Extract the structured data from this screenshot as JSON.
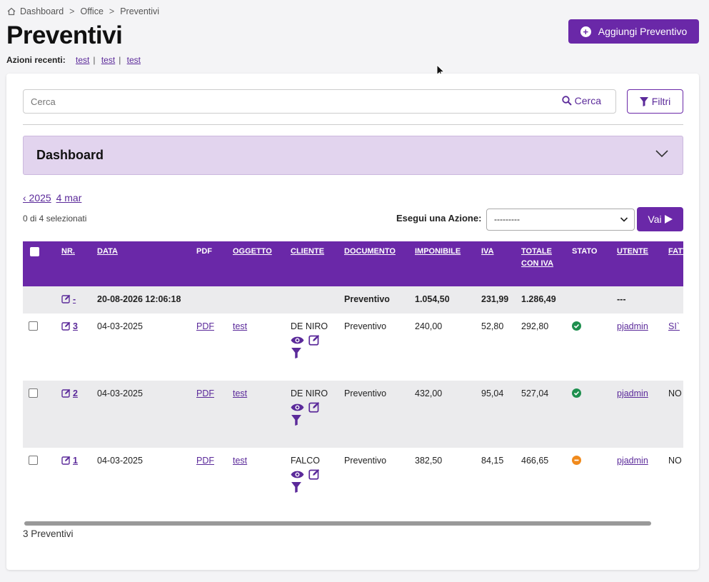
{
  "breadcrumb": [
    "Dashboard",
    "Office",
    "Preventivi"
  ],
  "page_title": "Preventivi",
  "recent": {
    "label": "Azioni recenti",
    "items": [
      "test",
      "test",
      "test"
    ]
  },
  "add_button": "Aggiungi Preventivo",
  "search": {
    "placeholder": "Cerca",
    "button": "Cerca"
  },
  "filters_button": "Filtri",
  "dashboard_panel": "Dashboard",
  "datenav": {
    "year": "‹ 2025",
    "day": "4 mar"
  },
  "selection": "0 di 4 selezionati",
  "action": {
    "label": "Esegui una Azione:",
    "selected": "---------",
    "go": "Vai"
  },
  "columns": [
    "NR.",
    "DATA",
    "PDF",
    "OGGETTO",
    "CLIENTE",
    "DOCUMENTO",
    "IMPONIBILE",
    "IVA",
    "TOTALE CON IVA",
    "STATO",
    "UTENTE",
    "FATT"
  ],
  "summary": {
    "nr": "-",
    "data": "20-08-2026 12:06:18",
    "documento": "Preventivo",
    "imponibile": "1.054,50",
    "iva": "231,99",
    "totale": "1.286,49",
    "utente": "---"
  },
  "rows": [
    {
      "nr": "3",
      "data": "04-03-2025",
      "pdf": "PDF",
      "oggetto": "test",
      "cliente": "DE NIRO",
      "documento": "Preventivo",
      "imponibile": "240,00",
      "iva": "52,80",
      "totale": "292,80",
      "stato": "#1e8f4e",
      "utente": "pjadmin",
      "fatt": "SI`"
    },
    {
      "nr": "2",
      "data": "04-03-2025",
      "pdf": "PDF",
      "oggetto": "test",
      "cliente": "DE NIRO",
      "documento": "Preventivo",
      "imponibile": "432,00",
      "iva": "95,04",
      "totale": "527,04",
      "stato": "#1e8f4e",
      "utente": "pjadmin",
      "fatt": "NO"
    },
    {
      "nr": "1",
      "data": "04-03-2025",
      "pdf": "PDF",
      "oggetto": "test",
      "cliente": "FALCO",
      "documento": "Preventivo",
      "imponibile": "382,50",
      "iva": "84,15",
      "totale": "466,65",
      "stato": "#f08a1c",
      "utente": "pjadmin",
      "fatt": "NO"
    }
  ],
  "footer_count": "3 Preventivi",
  "accent": "#6a28a8"
}
